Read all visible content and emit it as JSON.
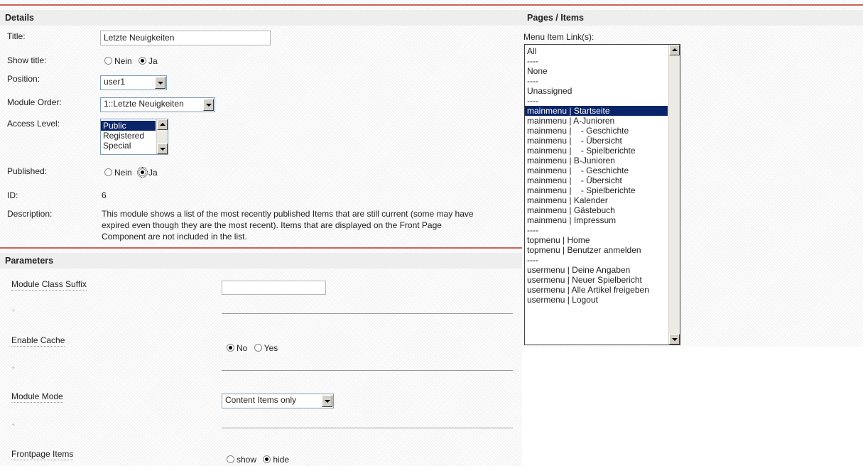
{
  "details": {
    "header": "Details",
    "title_label": "Title:",
    "title_value": "Letzte Neuigkeiten",
    "show_title_label": "Show title:",
    "show_title_options": [
      "Nein",
      "Ja"
    ],
    "show_title_selected": "Ja",
    "position_label": "Position:",
    "position_value": "user1",
    "module_order_label": "Module Order:",
    "module_order_value": "1::Letzte Neuigkeiten",
    "access_level_label": "Access Level:",
    "access_level_options": [
      "Public",
      "Registered",
      "Special"
    ],
    "access_level_selected": "Public",
    "published_label": "Published:",
    "published_options": [
      "Nein",
      "Ja"
    ],
    "published_selected": "Ja",
    "id_label": "ID:",
    "id_value": "6",
    "description_label": "Description:",
    "description_lines": [
      "This module shows a list of the most recently published Items that are still current (some may have",
      "expired even though they are the most recent). Items that are displayed on the Front Page",
      "Component are not included in the list."
    ]
  },
  "parameters": {
    "header": "Parameters",
    "class_suffix_label": "Module Class Suffix",
    "class_suffix_value": "",
    "enable_cache_label": "Enable Cache",
    "enable_cache_options": [
      "No",
      "Yes"
    ],
    "enable_cache_selected": "No",
    "module_mode_label": "Module Mode",
    "module_mode_value": "Content Items only",
    "frontpage_items_label": "Frontpage Items",
    "frontpage_items_options": [
      "show",
      "hide"
    ],
    "frontpage_items_selected": "hide"
  },
  "pages": {
    "header": "Pages / Items",
    "menu_link_label": "Menu Item Link(s):",
    "items": [
      "All",
      "----",
      "None",
      "----",
      "Unassigned",
      "----",
      "mainmenu | Startseite",
      "mainmenu | A-Junioren",
      "mainmenu |    - Geschichte",
      "mainmenu |    - Übersicht",
      "mainmenu |    - Spielberichte",
      "mainmenu | B-Junioren",
      "mainmenu |    - Geschichte",
      "mainmenu |    - Übersicht",
      "mainmenu |    - Spielberichte",
      "mainmenu | Kalender",
      "mainmenu | Gästebuch",
      "mainmenu | Impressum",
      "----",
      "topmenu | Home",
      "topmenu | Benutzer anmelden",
      "----",
      "usermenu | Deine Angaben",
      "usermenu | Neuer Spielbericht",
      "usermenu | Alle Artikel freigeben",
      "usermenu | Logout"
    ],
    "selected_index": 6
  }
}
